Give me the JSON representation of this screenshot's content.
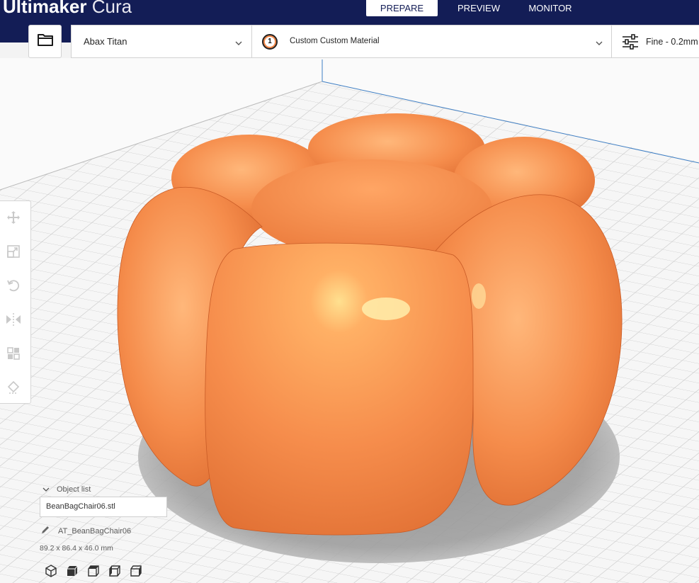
{
  "app": {
    "brand_bold": "Ultimaker",
    "brand_light": " Cura"
  },
  "stages": [
    {
      "label": "PREPARE",
      "active": true
    },
    {
      "label": "PREVIEW",
      "active": false
    },
    {
      "label": "MONITOR",
      "active": false
    }
  ],
  "toolbar": {
    "open_icon": "folder-icon",
    "printer": "Abax Titan",
    "extruder_number": "1",
    "material": "Custom Custom Material",
    "profile": "Fine - 0.2mm"
  },
  "tools": [
    "move-icon",
    "scale-icon",
    "rotate-icon",
    "mirror-icon",
    "per-model-settings-icon",
    "support-blocker-icon"
  ],
  "object_list": {
    "header": "Object list",
    "file": "BeanBagChair06.stl",
    "job_name": "AT_BeanBagChair06",
    "dimensions": "89.2 x 86.4 x 46.0 mm"
  },
  "view_buttons": [
    "3d-view-icon",
    "front-view-icon",
    "top-view-icon",
    "left-view-icon",
    "right-view-icon"
  ],
  "colors": {
    "header": "#131d56",
    "model": "#f58c4b",
    "model_highlight": "#ffe09a",
    "grid": "#c9c9c9",
    "build_plate": "#f7f7f7"
  }
}
